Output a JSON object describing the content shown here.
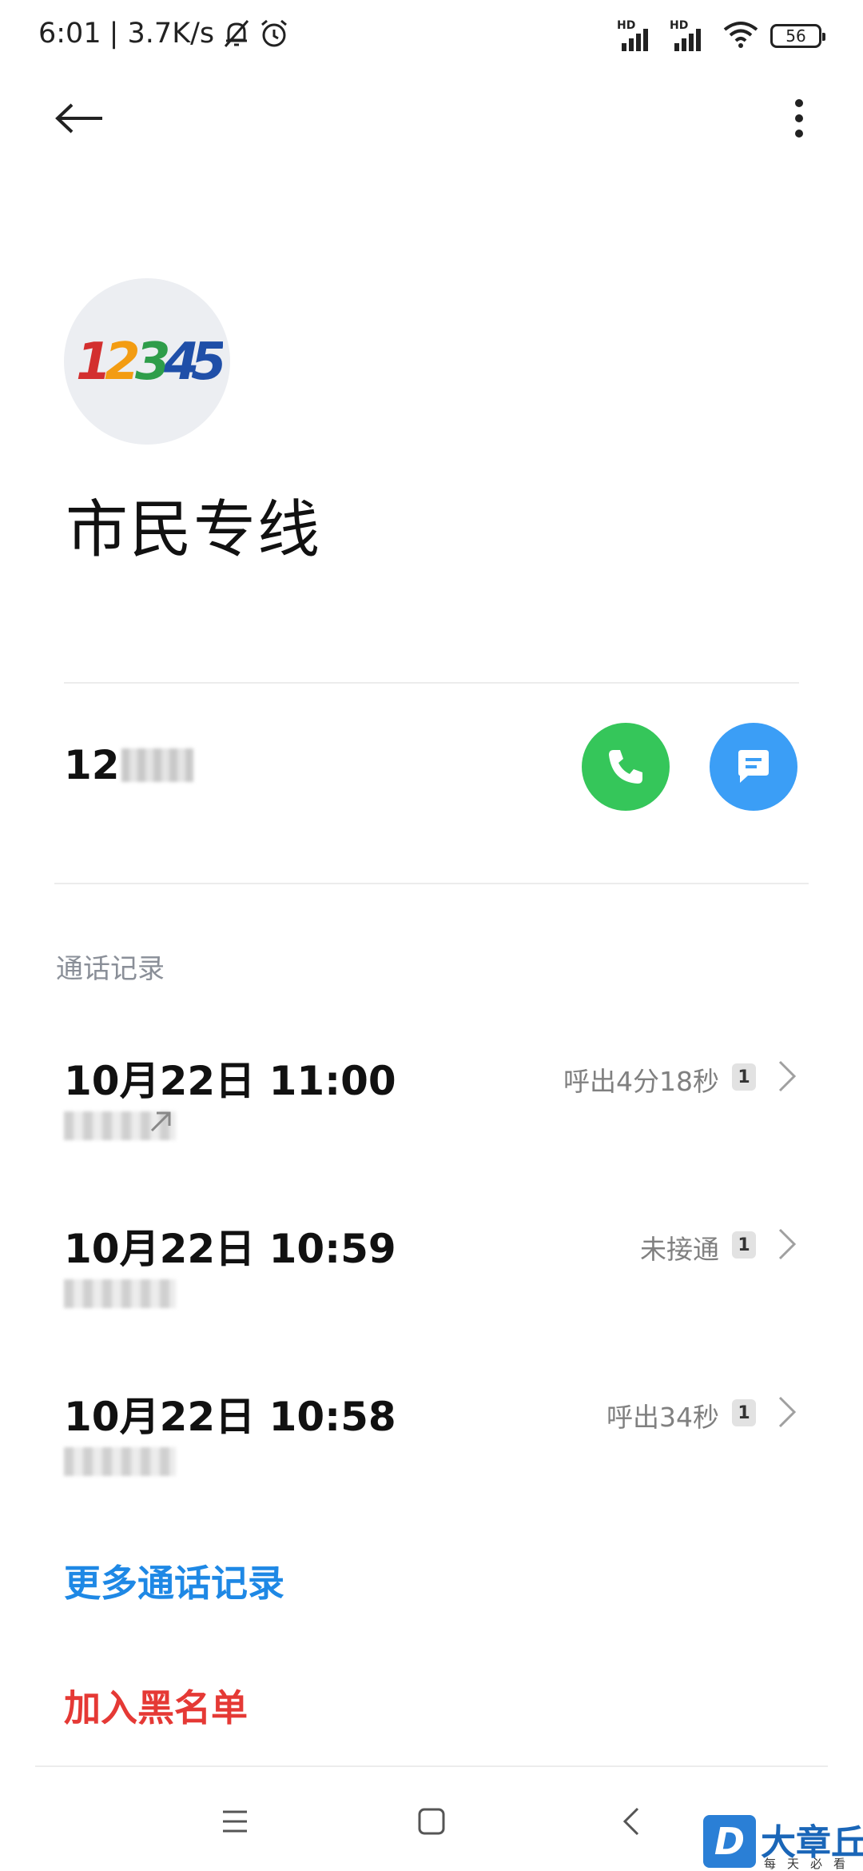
{
  "status_bar": {
    "time": "6:01",
    "net_speed": "| 3.7K/s",
    "signal_label_1": "HD",
    "signal_label_2": "HD",
    "battery": "56",
    "icons": [
      "mute-bell-icon",
      "alarm-clock-icon",
      "signal-icon",
      "signal-icon",
      "wifi-icon",
      "battery-icon"
    ]
  },
  "top_bar": {
    "back_icon": "back-arrow-icon",
    "more_icon": "more-vert-icon"
  },
  "contact": {
    "avatar_text": "12345",
    "name": "市民专线",
    "number_visible": "12"
  },
  "actions": {
    "call_icon": "phone-icon",
    "call_color": "#35c65a",
    "message_icon": "message-icon",
    "message_color": "#3b9ef6"
  },
  "call_log": {
    "title": "通话记录",
    "items": [
      {
        "date": "10月22日 11:00",
        "status": "呼出4分18秒",
        "sim": "1"
      },
      {
        "date": "10月22日 10:59",
        "status": "未接通",
        "sim": "1"
      },
      {
        "date": "10月22日 10:58",
        "status": "呼出34秒",
        "sim": "1"
      }
    ]
  },
  "links": {
    "more_log": "更多通话记录",
    "more_log_color": "#1e88e5",
    "blacklist": "加入黑名单",
    "blacklist_color": "#e53935"
  },
  "nav_bar": {
    "icons": [
      "menu-icon",
      "home-square-icon",
      "back-chevron-icon"
    ]
  },
  "watermark": {
    "logo_letter": "D",
    "text": "大章丘",
    "subtext": "每天必看"
  }
}
